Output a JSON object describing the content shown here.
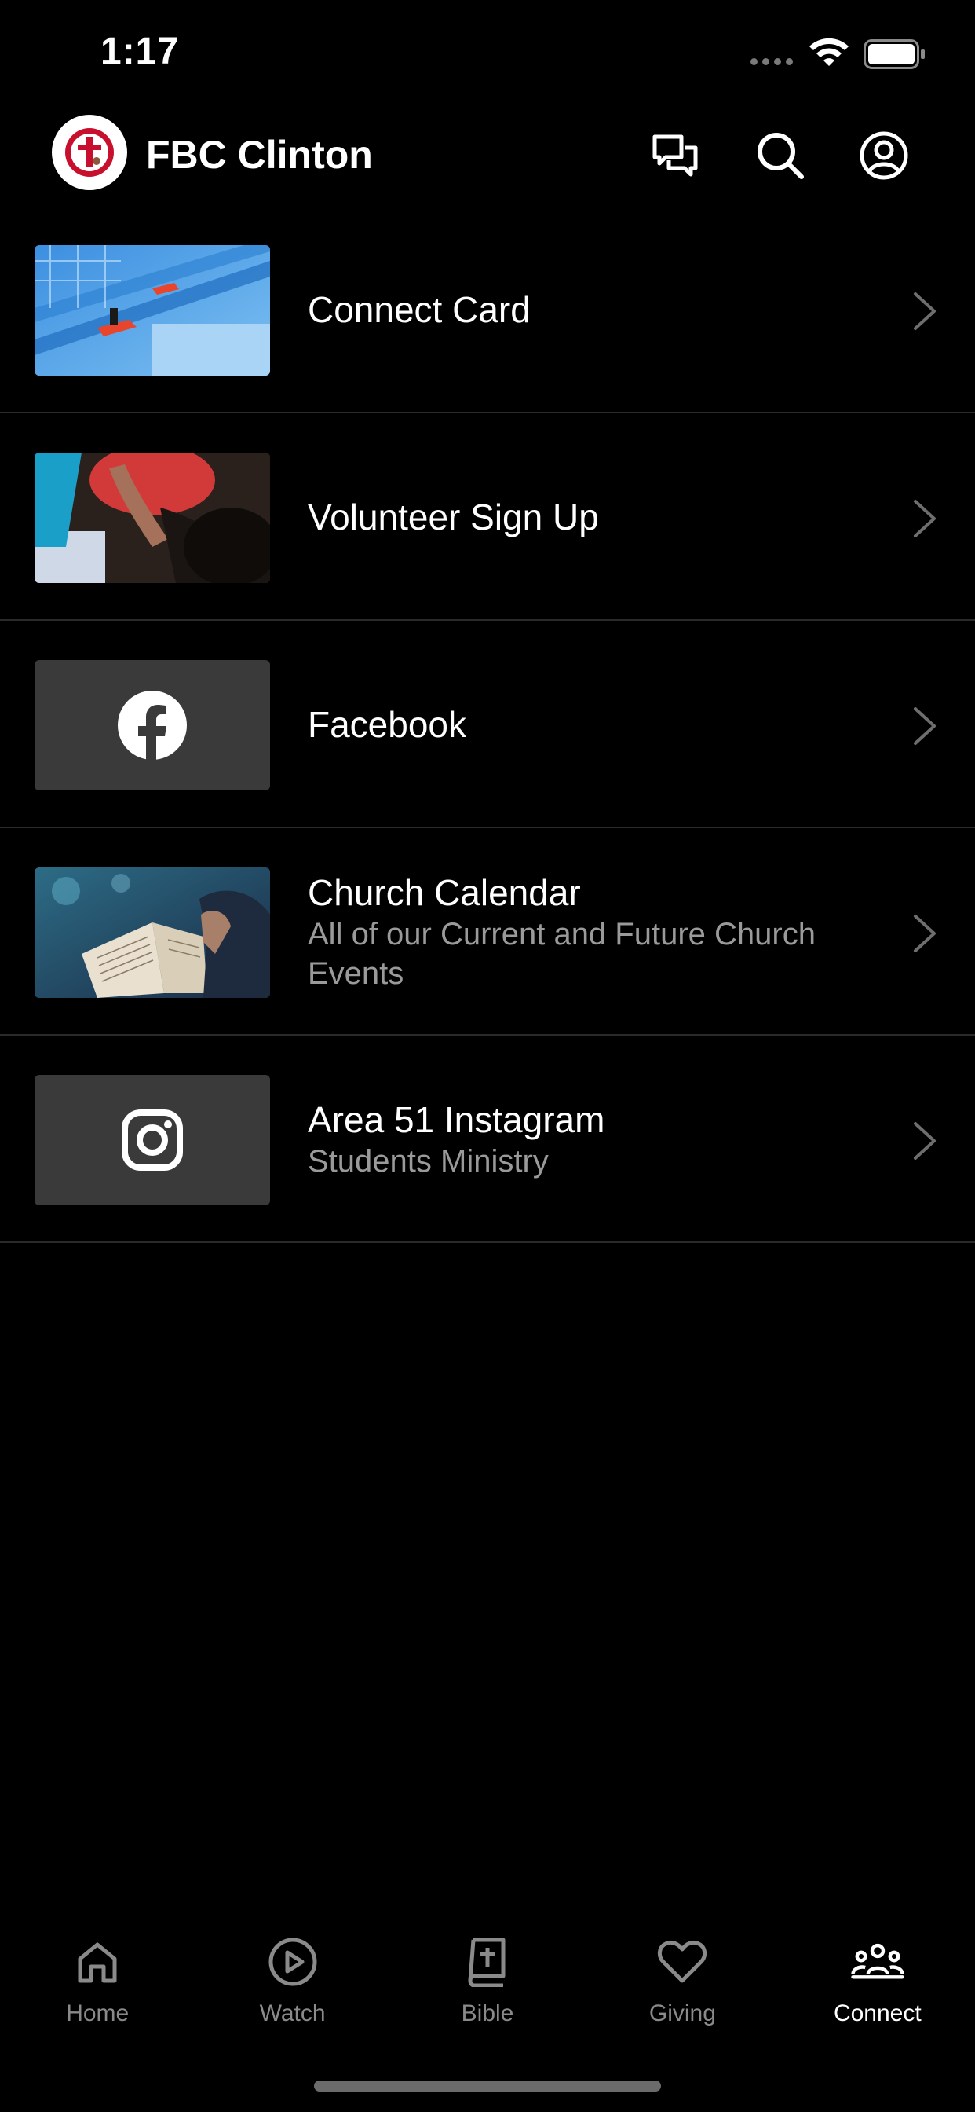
{
  "status": {
    "time": "1:17"
  },
  "header": {
    "app_title": "FBC Clinton"
  },
  "items": [
    {
      "title": "Connect Card",
      "subtitle": ""
    },
    {
      "title": "Volunteer Sign Up",
      "subtitle": ""
    },
    {
      "title": "Facebook",
      "subtitle": ""
    },
    {
      "title": "Church Calendar",
      "subtitle": "All of our Current and Future Church Events"
    },
    {
      "title": "Area 51 Instagram",
      "subtitle": "Students Ministry"
    }
  ],
  "tabs": [
    {
      "label": "Home",
      "icon": "home-icon"
    },
    {
      "label": "Watch",
      "icon": "play-circle-icon"
    },
    {
      "label": "Bible",
      "icon": "bible-icon"
    },
    {
      "label": "Giving",
      "icon": "heart-icon"
    },
    {
      "label": "Connect",
      "icon": "people-icon"
    }
  ],
  "colors": {
    "background": "#000000",
    "divider": "#2a2a2a",
    "secondary_text": "#9a9a9a",
    "tab_inactive": "#8a8a8a",
    "logo_red": "#c8102e"
  }
}
